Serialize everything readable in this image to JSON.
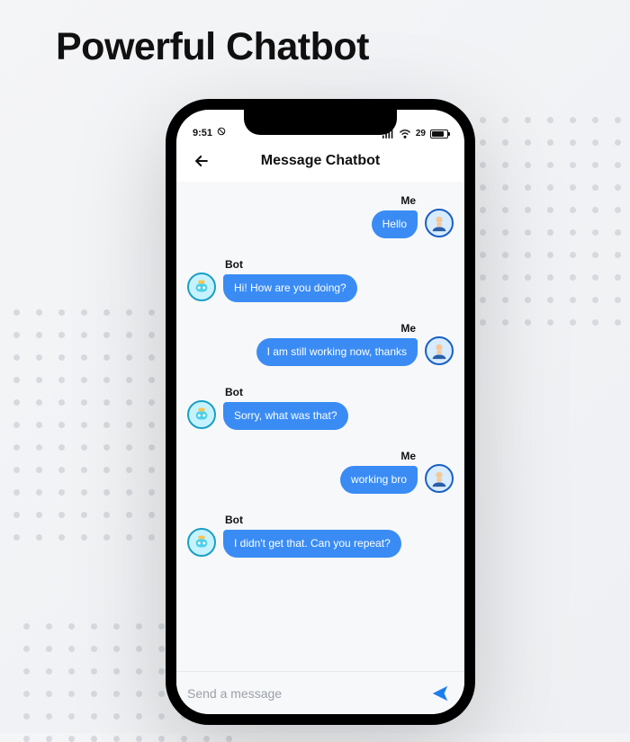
{
  "page": {
    "title": "Powerful Chatbot"
  },
  "status_bar": {
    "time": "9:51",
    "battery": "29"
  },
  "header": {
    "title": "Message Chatbot"
  },
  "labels": {
    "me": "Me",
    "bot": "Bot"
  },
  "messages": [
    {
      "from": "me",
      "text": "Hello"
    },
    {
      "from": "bot",
      "text": "Hi! How are you doing?"
    },
    {
      "from": "me",
      "text": "I am still working now, thanks"
    },
    {
      "from": "bot",
      "text": "Sorry, what was that?"
    },
    {
      "from": "me",
      "text": "working bro"
    },
    {
      "from": "bot",
      "text": "I didn't get that. Can you repeat?"
    }
  ],
  "composer": {
    "placeholder": "Send a message"
  },
  "colors": {
    "bubble": "#3a8cf4",
    "send_icon": "#1d7df0"
  }
}
